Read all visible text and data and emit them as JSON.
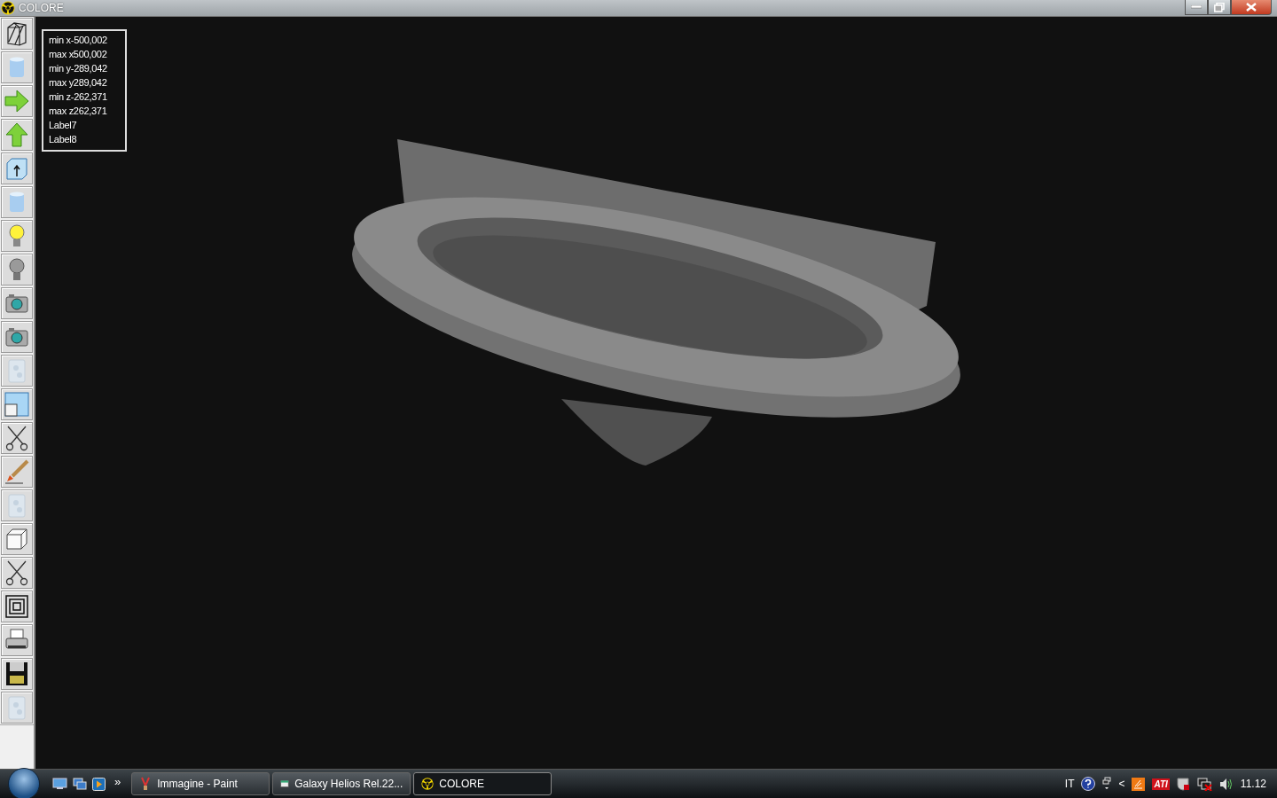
{
  "window": {
    "title": "COLORE"
  },
  "toolbar": [
    {
      "kind": "wireframe"
    },
    {
      "kind": "cylinder"
    },
    {
      "kind": "arrow-right"
    },
    {
      "kind": "arrow-up"
    },
    {
      "kind": "box-arrow"
    },
    {
      "kind": "cylinder"
    },
    {
      "kind": "bulb-on"
    },
    {
      "kind": "bulb-off"
    },
    {
      "kind": "camera"
    },
    {
      "kind": "camera"
    },
    {
      "kind": "texture"
    },
    {
      "kind": "window"
    },
    {
      "kind": "scissors"
    },
    {
      "kind": "brush"
    },
    {
      "kind": "texture"
    },
    {
      "kind": "cube"
    },
    {
      "kind": "scissors"
    },
    {
      "kind": "squares"
    },
    {
      "kind": "printer"
    },
    {
      "kind": "floppy"
    },
    {
      "kind": "texture"
    }
  ],
  "info_labels": [
    "min x-500,002",
    "max x500,002",
    "min y-289,042",
    "max y289,042",
    "min z-262,371",
    "max z262,371",
    "Label7",
    "Label8"
  ],
  "taskbar": {
    "more": "»",
    "tasks": [
      {
        "label": "Immagine - Paint",
        "kind": "paint",
        "selected": false
      },
      {
        "label": "Galaxy Helios  Rel.22...",
        "kind": "app",
        "selected": false
      },
      {
        "label": "COLORE",
        "kind": "radiation",
        "selected": true
      }
    ],
    "tray": {
      "language": "IT",
      "collapse": "<",
      "ati": "ATI",
      "clock": "11.12"
    }
  }
}
